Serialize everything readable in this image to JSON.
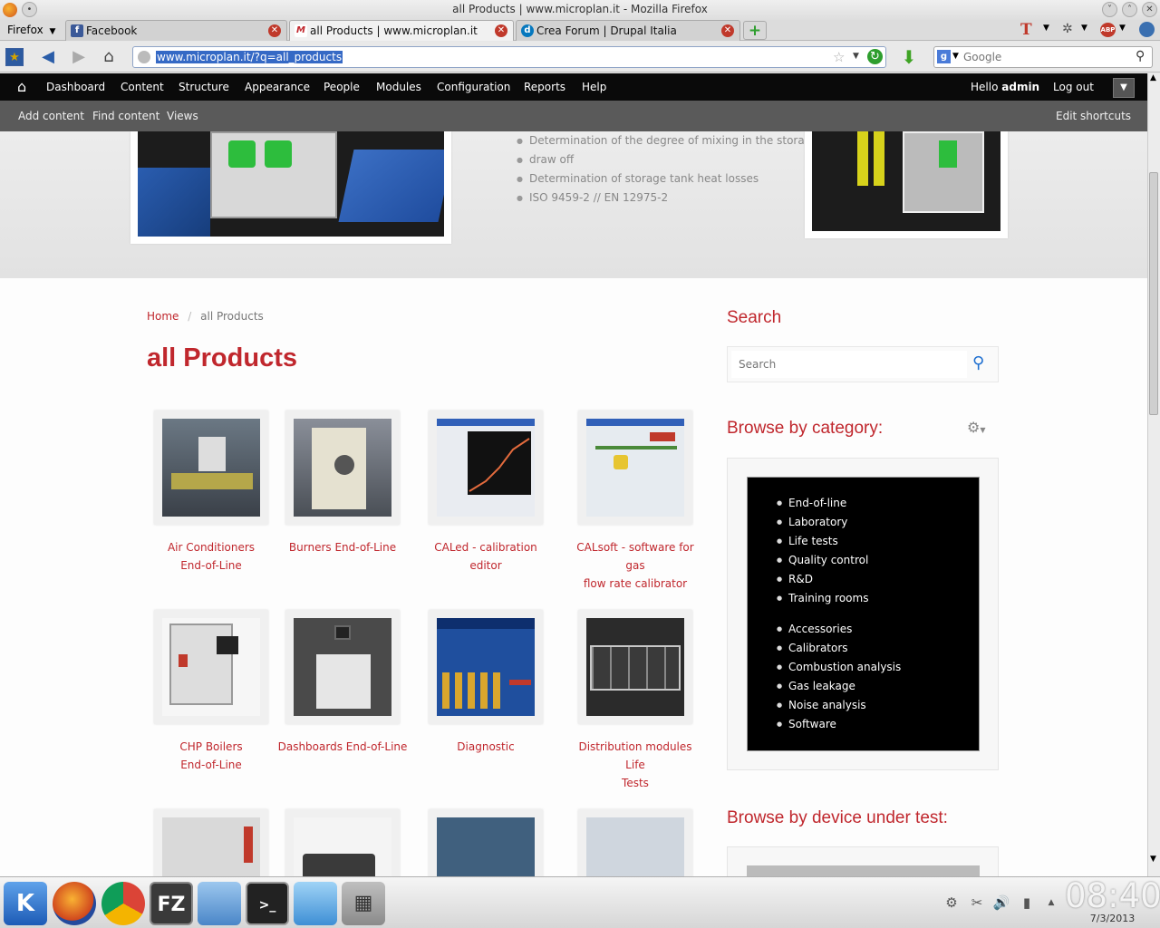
{
  "window": {
    "title": "all Products | www.microplan.it - Mozilla Firefox",
    "app_menu": "Firefox"
  },
  "tabs": [
    {
      "label": "Facebook",
      "favicon": "f"
    },
    {
      "label": "all Products | www.microplan.it",
      "favicon": "M"
    },
    {
      "label": "Crea Forum | Drupal Italia",
      "favicon": "d"
    }
  ],
  "new_tab_icon": "+",
  "navbar": {
    "url": "www.microplan.it/?q=all_products",
    "search_placeholder": "Google"
  },
  "admin_toolbar": {
    "items": [
      "Dashboard",
      "Content",
      "Structure",
      "Appearance",
      "People",
      "Modules",
      "Configuration",
      "Reports",
      "Help"
    ],
    "hello_prefix": "Hello",
    "user": "admin",
    "logout": "Log out"
  },
  "shortcuts": {
    "items": [
      "Add content",
      "Find content",
      "Views"
    ],
    "edit": "Edit shortcuts"
  },
  "banner": {
    "bullets": [
      "Determination of the degree of mixing in the storag",
      "draw off",
      "Determination of storage tank heat losses",
      "ISO 9459-2 // EN 12975-2"
    ]
  },
  "breadcrumb": {
    "home": "Home",
    "separator": "/",
    "current": "all Products"
  },
  "page_title": "all Products",
  "products": [
    {
      "line1": "Air Conditioners",
      "line2": "End-of-Line"
    },
    {
      "line1": "Burners End-of-Line",
      "line2": ""
    },
    {
      "line1": "CALed - calibration editor",
      "line2": ""
    },
    {
      "line1": "CALsoft - software for gas",
      "line2": "flow rate calibrator"
    },
    {
      "line1": "CHP Boilers",
      "line2": "End-of-Line"
    },
    {
      "line1": "Dashboards End-of-Line",
      "line2": ""
    },
    {
      "line1": "Diagnostic",
      "line2": ""
    },
    {
      "line1": "Distribution modules Life",
      "line2": "Tests"
    }
  ],
  "sidebar": {
    "search_title": "Search",
    "search_placeholder": "Search",
    "category_title": "Browse by category:",
    "categories_group1": [
      "End-of-line",
      "Laboratory",
      "Life tests",
      "Quality control",
      "R&D",
      "Training rooms"
    ],
    "categories_group2": [
      "Accessories",
      "Calibrators",
      "Combustion analysis",
      "Gas leakage",
      "Noise analysis",
      "Software"
    ],
    "device_title": "Browse by device under test:"
  },
  "taskbar": {
    "time": "08:40",
    "date": "7/3/2013"
  },
  "colors": {
    "accent": "#c0272d",
    "toolbar": "#0a0a0a",
    "shortcuts": "#5a5a5a"
  }
}
